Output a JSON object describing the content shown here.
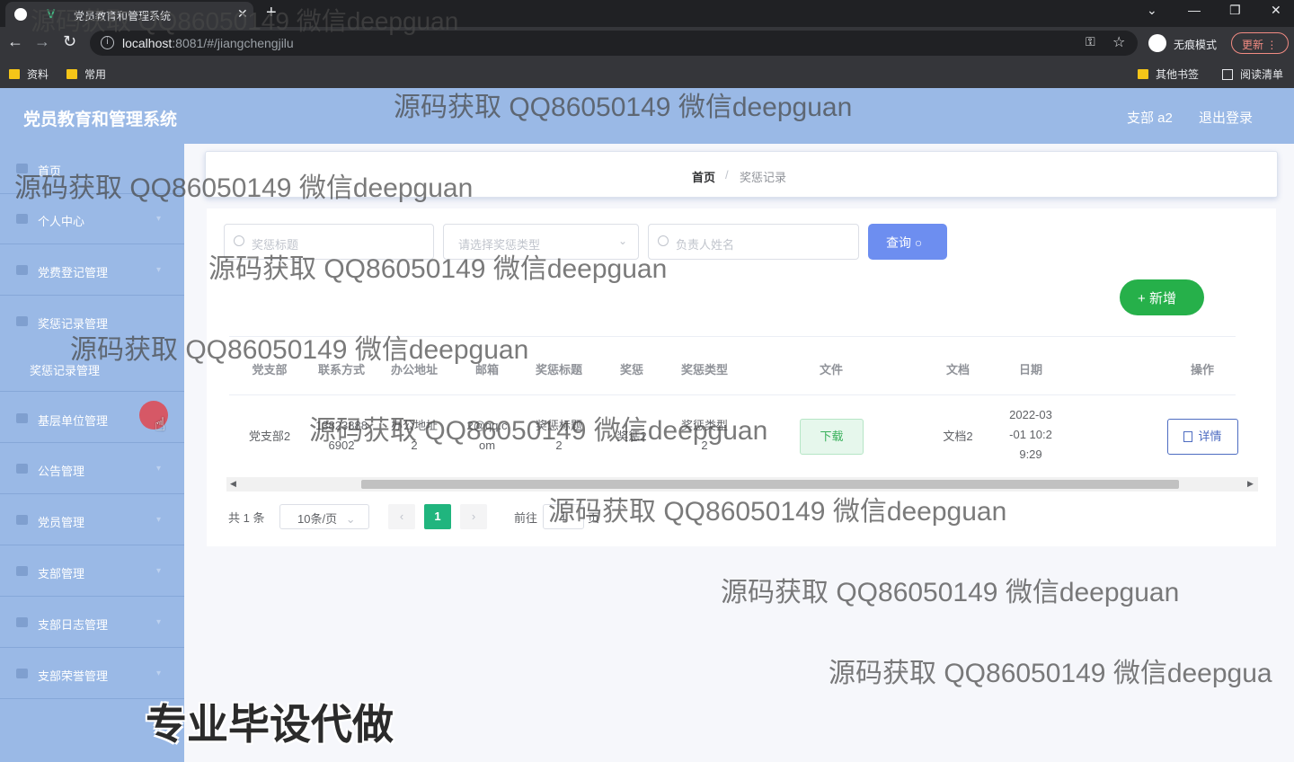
{
  "browser": {
    "tab_title": "党员教育和管理系统",
    "tab_logo": "V",
    "url_host": "localhost",
    "url_path": ":8081/#/jiangchengjilu",
    "incognito_label": "无痕模式",
    "update_label": "更新",
    "bookmarks": [
      "资料",
      "常用"
    ],
    "other_bookmarks": "其他书签",
    "reading_list": "阅读清单"
  },
  "header": {
    "title": "党员教育和管理系统",
    "user": "支部 a2",
    "logout": "退出登录"
  },
  "sidebar": {
    "items": [
      {
        "label": "首页",
        "icon": "home-icon"
      },
      {
        "label": "个人中心",
        "icon": "user-icon"
      },
      {
        "label": "党费登记管理",
        "icon": "flag-icon"
      },
      {
        "label": "奖惩记录管理",
        "icon": "trophy-icon"
      },
      {
        "label": "基层单位管理",
        "icon": "building-icon"
      },
      {
        "label": "公告管理",
        "icon": "bell-icon"
      },
      {
        "label": "党员管理",
        "icon": "list-icon"
      },
      {
        "label": "支部管理",
        "icon": "circle-icon"
      },
      {
        "label": "支部日志管理",
        "icon": "log-icon"
      },
      {
        "label": "支部荣誉管理",
        "icon": "award-icon"
      }
    ],
    "submenu_label": "奖惩记录管理"
  },
  "breadcrumb": {
    "home": "首页",
    "separator": "/",
    "current": "奖惩记录"
  },
  "search": {
    "title_placeholder": "奖惩标题",
    "type_placeholder": "请选择奖惩类型",
    "person_placeholder": "负责人姓名",
    "query_label": "查询",
    "add_label": "新增"
  },
  "table": {
    "columns": [
      "党支部",
      "联系方式",
      "办公地址",
      "邮箱",
      "奖惩标题",
      "奖惩",
      "奖惩类型",
      "文件",
      "文档",
      "日期",
      "操作"
    ],
    "rows": [
      {
        "branch": "党支部2",
        "contact": "13823888\n6902",
        "address": "办公地址\n2",
        "email": "2@qq.c\nom",
        "title": "奖惩标题\n2",
        "award": "奖惩2",
        "type": "奖惩类型\n2",
        "file_action": "下载",
        "document": "文档2",
        "date": "2022-03\n-01 10:2\n9:29",
        "detail_action": "详情"
      }
    ]
  },
  "pagination": {
    "total": "共 1 条",
    "page_size": "10条/页",
    "prev": "‹",
    "current": "1",
    "next": "›",
    "goto_label": "前往",
    "goto_value": "1",
    "page_suffix": "页"
  },
  "watermarks": {
    "text": "源码获取 QQ86050149 微信deepguan",
    "text_truncated": "源码获取 QQ86050149 微信deepgua",
    "promo": "专业毕设代做"
  },
  "colors": {
    "sidebar_bg": "#9ab9e6",
    "primary_button": "#6d8ef0",
    "add_button": "#26b04a",
    "active_page": "#20b57e"
  }
}
